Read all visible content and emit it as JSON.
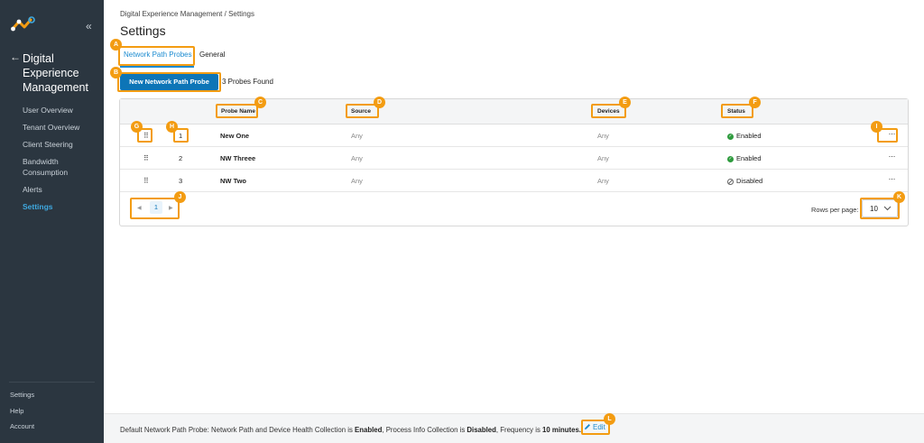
{
  "sidebar": {
    "collapse_glyph": "«",
    "back_glyph": "←",
    "app_title": "Digital Experience Management",
    "items": [
      {
        "label": "User Overview"
      },
      {
        "label": "Tenant Overview"
      },
      {
        "label": "Client Steering"
      },
      {
        "label": "Bandwidth Consumption"
      },
      {
        "label": "Alerts"
      },
      {
        "label": "Settings",
        "active": true
      }
    ],
    "bottom": [
      {
        "label": "Settings"
      },
      {
        "label": "Help"
      },
      {
        "label": "Account"
      }
    ]
  },
  "breadcrumb": "Digital Experience Management / Settings",
  "page_title": "Settings",
  "tabs": [
    {
      "label": "Network Path Probes",
      "active": true
    },
    {
      "label": "General"
    }
  ],
  "toolbar": {
    "new_button": "New Network Path Probe",
    "found_text": "3 Probes Found"
  },
  "table": {
    "columns": [
      "Probe Name",
      "Source",
      "Devices",
      "Status"
    ],
    "rows": [
      {
        "order": "1",
        "name": "New One",
        "source": "Any",
        "devices": "Any",
        "status": "Enabled"
      },
      {
        "order": "2",
        "name": "NW Threee",
        "source": "Any",
        "devices": "Any",
        "status": "Enabled"
      },
      {
        "order": "3",
        "name": "NW Two",
        "source": "Any",
        "devices": "Any",
        "status": "Disabled"
      }
    ],
    "row_menu_glyph": "···",
    "grip_glyph": "⠿"
  },
  "pagination": {
    "current_page": "1",
    "prev_glyph": "◀",
    "next_glyph": "▶"
  },
  "rows_per_page": {
    "label": "Rows per page:",
    "value": "10"
  },
  "footer": {
    "prefix": "Default Network Path Probe: Network Path and Device Health Collection is ",
    "nph_status": "Enabled",
    "mid": ", Process Info Collection is ",
    "proc_status": "Disabled",
    "freq_prefix": ", Frequency is ",
    "frequency": "10 minutes.",
    "edit_label": "Edit"
  },
  "callouts": [
    "A",
    "B",
    "C",
    "D",
    "E",
    "F",
    "G",
    "H",
    "I",
    "J",
    "K",
    "L"
  ],
  "colors": {
    "accent": "#1b8bd0",
    "button": "#0d75b7",
    "callout": "#f39c12",
    "sidebar": "#2b3640",
    "enabled": "#2e9b3e"
  }
}
